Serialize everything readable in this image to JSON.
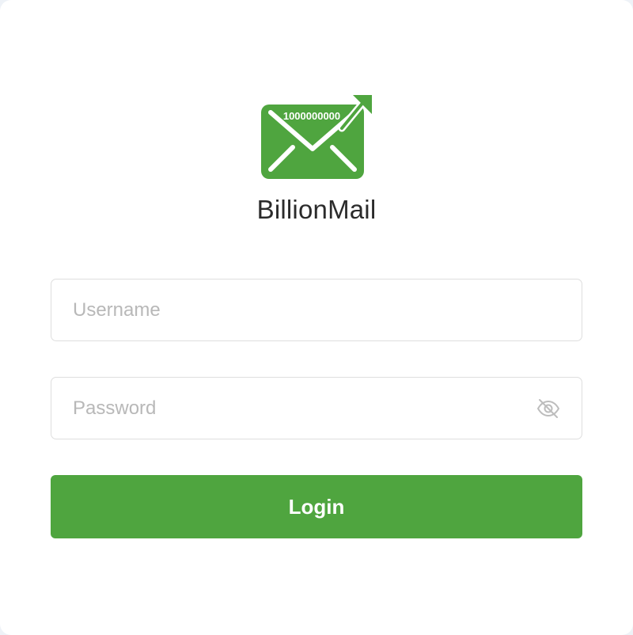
{
  "brand": {
    "name": "BillionMail",
    "logo_text": "1000000000",
    "logo_color": "#4fa53f"
  },
  "form": {
    "username_placeholder": "Username",
    "password_placeholder": "Password",
    "password_toggle_icon": "eye-off-icon",
    "login_label": "Login"
  },
  "colors": {
    "primary": "#4fa53f",
    "border": "#dedede",
    "placeholder": "#b8b8b8",
    "background": "#eef2f7"
  }
}
